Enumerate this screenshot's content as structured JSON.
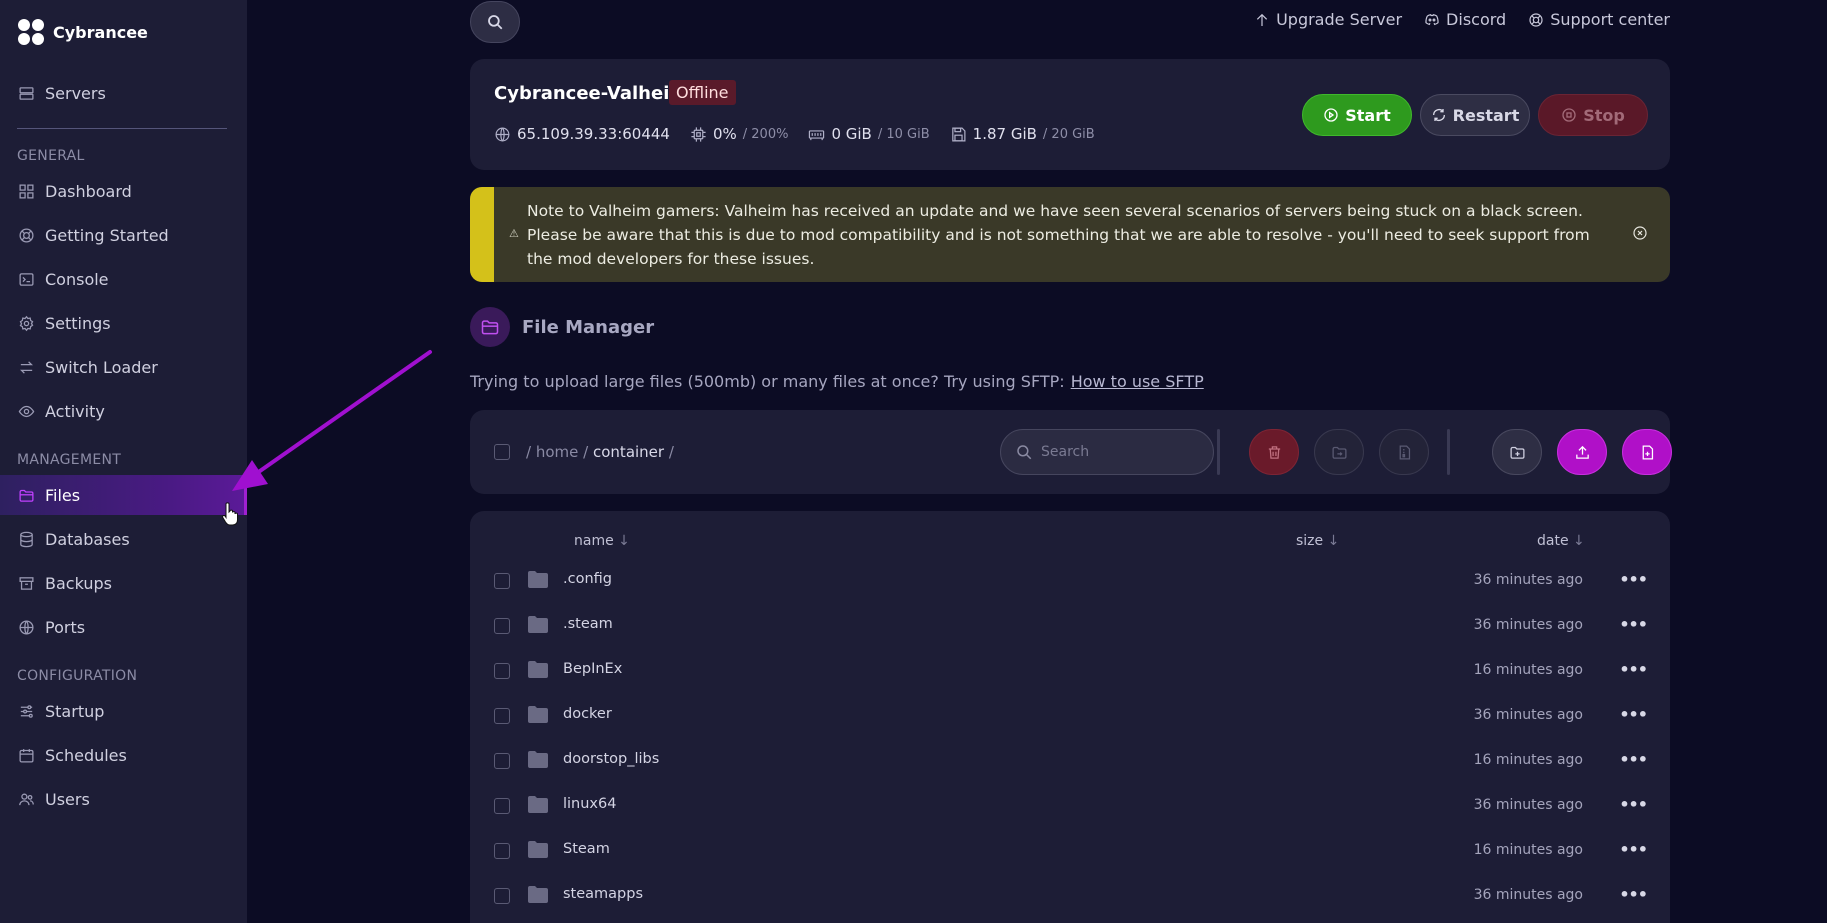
{
  "brand": {
    "name": "Cybrancee"
  },
  "sidebar": {
    "top_items": [
      {
        "label": "Servers",
        "icon": "server-icon"
      }
    ],
    "sections": {
      "general": "GENERAL",
      "management": "MANAGEMENT",
      "configuration": "CONFIGURATION"
    },
    "general_items": [
      {
        "label": "Dashboard",
        "icon": "grid-icon"
      },
      {
        "label": "Getting Started",
        "icon": "lifebuoy-icon"
      },
      {
        "label": "Console",
        "icon": "terminal-icon"
      },
      {
        "label": "Settings",
        "icon": "gear-icon"
      },
      {
        "label": "Switch Loader",
        "icon": "swap-icon"
      },
      {
        "label": "Activity",
        "icon": "eye-icon"
      }
    ],
    "management_items": [
      {
        "label": "Files",
        "icon": "folder-icon",
        "active": true
      },
      {
        "label": "Databases",
        "icon": "database-icon"
      },
      {
        "label": "Backups",
        "icon": "archive-icon"
      },
      {
        "label": "Ports",
        "icon": "globe-icon"
      }
    ],
    "configuration_items": [
      {
        "label": "Startup",
        "icon": "sliders-icon"
      },
      {
        "label": "Schedules",
        "icon": "calendar-icon"
      },
      {
        "label": "Users",
        "icon": "users-icon"
      }
    ]
  },
  "topbar": {
    "upgrade": "Upgrade Server",
    "discord": "Discord",
    "support": "Support center"
  },
  "server": {
    "name": "Cybrancee-Valheim",
    "status": "Offline",
    "address": "65.109.39.33:60444",
    "cpu": "0%",
    "cpu_limit": "/ 200%",
    "memory": "0 GiB",
    "memory_limit": "/ 10 GiB",
    "disk": "1.87 GiB",
    "disk_limit": "/ 20 GiB",
    "start_label": "Start",
    "restart_label": "Restart",
    "stop_label": "Stop"
  },
  "notice": {
    "warn_glyph": "⚠",
    "text": "Note to Valheim gamers: Valheim has received an update and we have seen several scenarios of servers being stuck on a black screen. Please be aware that this is due to mod compatibility and is not something that we are able to resolve - you'll need to seek support from the mod developers for these issues."
  },
  "file_manager": {
    "title": "File Manager",
    "sftp_note": "Trying to upload large files (500mb) or many files at once? Try using SFTP:",
    "sftp_link": "How to use SFTP",
    "breadcrumb": {
      "sep": "/",
      "home": "home",
      "current": "container"
    },
    "search_placeholder": "Search",
    "columns": {
      "name": "name",
      "size": "size",
      "date": "date",
      "sort_arrow": "↓"
    },
    "files": [
      {
        "name": ".config",
        "date": "36 minutes ago"
      },
      {
        "name": ".steam",
        "date": "36 minutes ago"
      },
      {
        "name": "BepInEx",
        "date": "16 minutes ago"
      },
      {
        "name": "docker",
        "date": "36 minutes ago"
      },
      {
        "name": "doorstop_libs",
        "date": "16 minutes ago"
      },
      {
        "name": "linux64",
        "date": "36 minutes ago"
      },
      {
        "name": "Steam",
        "date": "16 minutes ago"
      },
      {
        "name": "steamapps",
        "date": "36 minutes ago"
      }
    ],
    "more_glyph": "•••"
  },
  "colors": {
    "accent": "#b010c8",
    "start": "#2e9a1e",
    "stop": "#5a1828",
    "warning_bar": "#d4c11a",
    "annotation_arrow": "#a010d0"
  }
}
